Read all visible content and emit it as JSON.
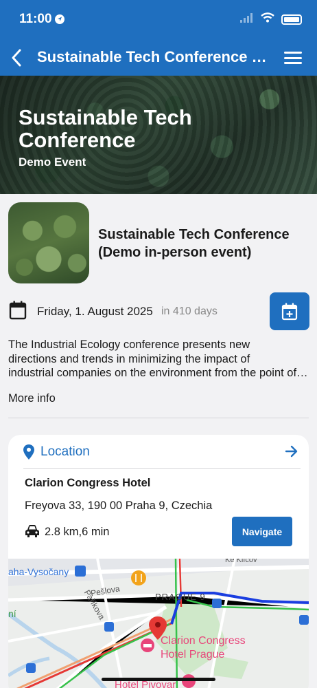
{
  "status_bar": {
    "time": "11:00"
  },
  "header": {
    "title": "Sustainable Tech Conference (Demo in-person event)"
  },
  "hero": {
    "title": "Sustainable Tech Conference",
    "subtitle": "Demo Event"
  },
  "event": {
    "title": "Sustainable Tech Conference (Demo in-person event)",
    "date": "Friday, 1. August 2025",
    "days_until": "in 410 days",
    "description_lines": [
      "The Industrial Ecology conference presents new",
      "directions and trends in minimizing the impact of",
      "industrial companies on the environment from the point of view of sustainability"
    ],
    "more_info_label": "More info"
  },
  "location": {
    "label": "Location",
    "venue": "Clarion Congress Hotel",
    "address": "Freyova 33, 190 00 Praha 9, Czechia",
    "distance": "2.8 km,6 min",
    "navigate_label": "Navigate"
  },
  "map": {
    "labels": {
      "district": "aha-Vysočany",
      "ke_klicov": "Ke Klíčov",
      "peslova": "Pešlova",
      "parikova": "Paříkova",
      "prague9": "PRAGUE 9",
      "ni": "ní",
      "hotel_line1": "Clarion Congress",
      "hotel_line2": "Hotel Prague",
      "pivovar": "Hotel Pivovar"
    },
    "colors": {
      "route": "#1a3ee0",
      "poi": "#e8457a",
      "pin": "#e53935",
      "food": "#f2a31b"
    }
  },
  "colors": {
    "brand": "#1f6fbf"
  }
}
